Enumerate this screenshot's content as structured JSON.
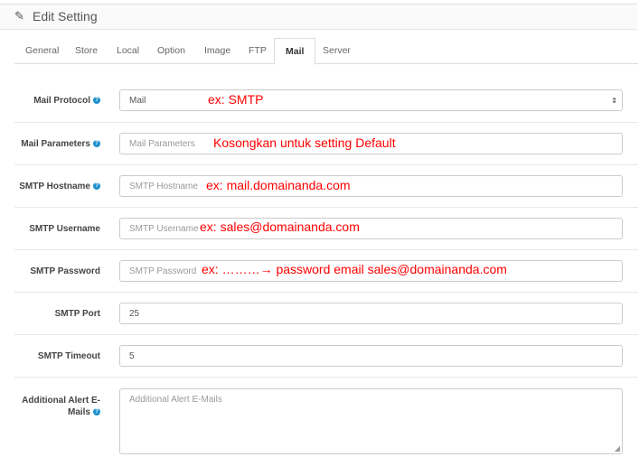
{
  "header": {
    "icon": "pencil-icon",
    "title": "Edit Setting"
  },
  "tabs": [
    "General",
    "Store",
    "Local",
    "Option",
    "Image",
    "FTP",
    "Mail",
    "Server"
  ],
  "active_tab": "Mail",
  "fields": {
    "mail_protocol": {
      "label": "Mail Protocol",
      "value": "Mail",
      "note": "ex: SMTP"
    },
    "mail_parameters": {
      "label": "Mail Parameters",
      "placeholder": "Mail Parameters",
      "note": "Kosongkan untuk setting Default"
    },
    "smtp_hostname": {
      "label": "SMTP Hostname",
      "placeholder": "SMTP Hostname",
      "note": "ex: mail.domainanda.com"
    },
    "smtp_username": {
      "label": "SMTP Username",
      "placeholder": "SMTP Username",
      "note": "ex: sales@domainanda.com"
    },
    "smtp_password": {
      "label": "SMTP Password",
      "placeholder": "SMTP Password",
      "note": "ex: ………→ password email sales@domainanda.com"
    },
    "smtp_port": {
      "label": "SMTP Port",
      "value": "25"
    },
    "smtp_timeout": {
      "label": "SMTP Timeout",
      "value": "5"
    },
    "alert_emails": {
      "label": "Additional Alert E-Mails",
      "placeholder": "Additional Alert E-Mails"
    }
  },
  "colors": {
    "annotation": "#ff0000",
    "help": "#1e91cf"
  }
}
